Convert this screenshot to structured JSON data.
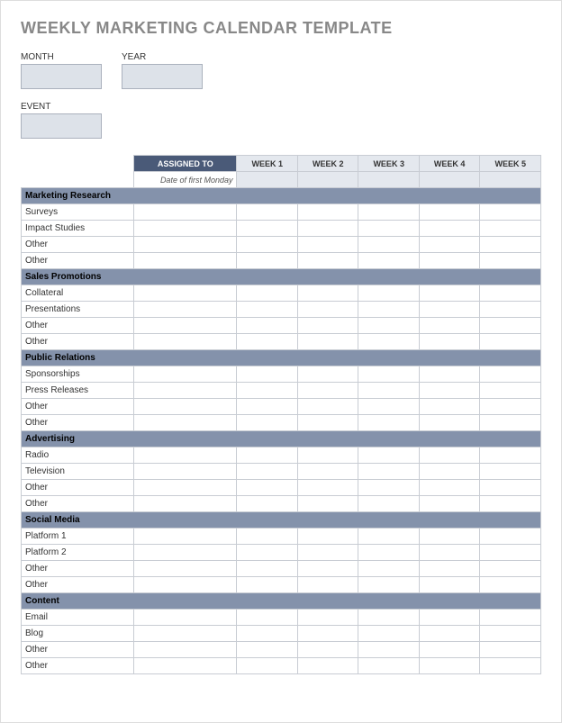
{
  "title": "WEEKLY MARKETING CALENDAR TEMPLATE",
  "fields": {
    "month_label": "MONTH",
    "year_label": "YEAR",
    "event_label": "EVENT"
  },
  "headers": {
    "assigned_to": "ASSIGNED TO",
    "date_note": "Date of first Monday",
    "weeks": [
      "WEEK 1",
      "WEEK 2",
      "WEEK 3",
      "WEEK 4",
      "WEEK 5"
    ]
  },
  "sections": [
    {
      "name": "Marketing Research",
      "items": [
        "Surveys",
        "Impact Studies",
        "Other",
        "Other"
      ]
    },
    {
      "name": "Sales Promotions",
      "items": [
        "Collateral",
        "Presentations",
        "Other",
        "Other"
      ]
    },
    {
      "name": "Public Relations",
      "items": [
        "Sponsorships",
        "Press Releases",
        "Other",
        "Other"
      ]
    },
    {
      "name": "Advertising",
      "items": [
        "Radio",
        "Television",
        "Other",
        "Other"
      ]
    },
    {
      "name": "Social Media",
      "items": [
        "Platform 1",
        "Platform 2",
        "Other",
        "Other"
      ]
    },
    {
      "name": "Content",
      "items": [
        "Email",
        "Blog",
        "Other",
        "Other"
      ]
    }
  ]
}
